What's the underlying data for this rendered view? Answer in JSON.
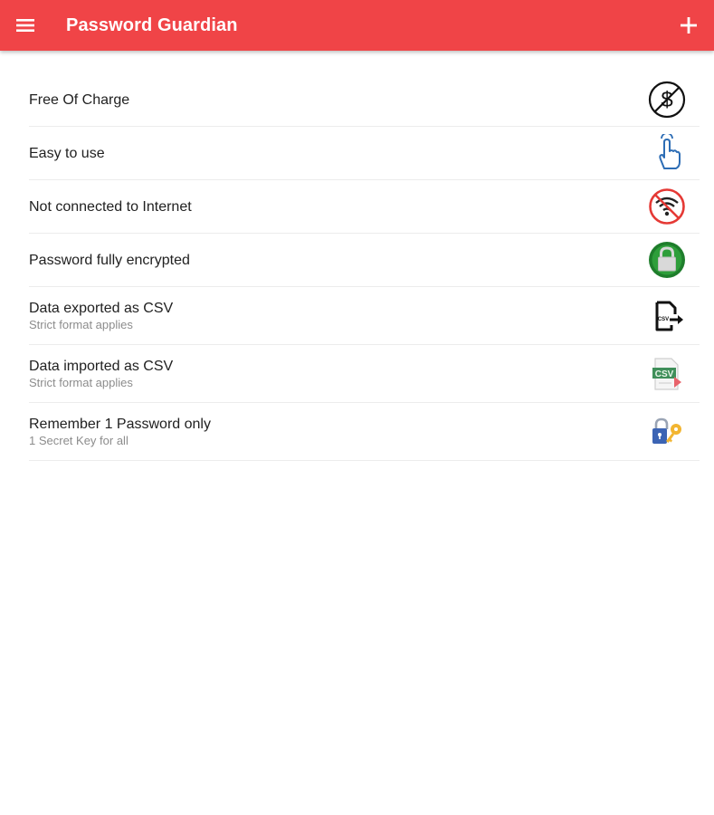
{
  "app": {
    "title": "Password Guardian",
    "accent_color": "#f04447",
    "menu_icon": "hamburger-menu-icon",
    "add_icon": "plus-icon"
  },
  "features": [
    {
      "title": "Free Of Charge",
      "subtitle": "",
      "icon": "no-dollar-icon"
    },
    {
      "title": "Easy to use",
      "subtitle": "",
      "icon": "tap-hand-icon"
    },
    {
      "title": "Not connected to Internet",
      "subtitle": "",
      "icon": "no-wifi-icon"
    },
    {
      "title": "Password fully encrypted",
      "subtitle": "",
      "icon": "lock-icon"
    },
    {
      "title": "Data exported as CSV",
      "subtitle": "Strict format applies",
      "icon": "csv-export-icon"
    },
    {
      "title": "Data imported as CSV",
      "subtitle": "Strict format applies",
      "icon": "csv-import-icon"
    },
    {
      "title": "Remember 1 Password only",
      "subtitle": "1 Secret Key for all",
      "icon": "lock-key-icon"
    }
  ]
}
